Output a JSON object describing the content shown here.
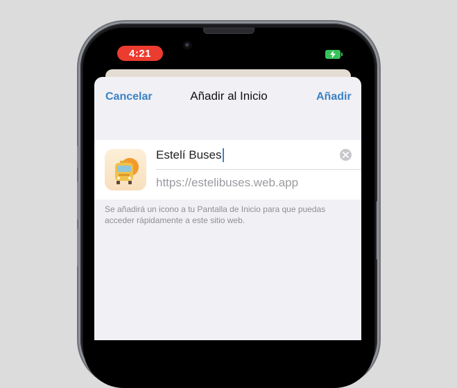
{
  "status_bar": {
    "time": "4:21",
    "battery_state": "charging",
    "time_pill_color": "#ec3b2f",
    "battery_color": "#36c259"
  },
  "nav": {
    "cancel_label": "Cancelar",
    "title": "Añadir al Inicio",
    "add_label": "Añadir"
  },
  "form": {
    "name_value": "Estelí Buses",
    "url_value": "https://estelibuses.web.app",
    "hint": "Se añadirá un icono a tu Pantalla de Inicio para que puedas acceder rápidamente a este sitio web."
  },
  "icons": {
    "app": "bus-app-icon",
    "clear": "clear-icon",
    "battery": "battery-icon"
  },
  "colors": {
    "accent": "#3b82c4",
    "sheet_bg": "#f1f0f5"
  }
}
